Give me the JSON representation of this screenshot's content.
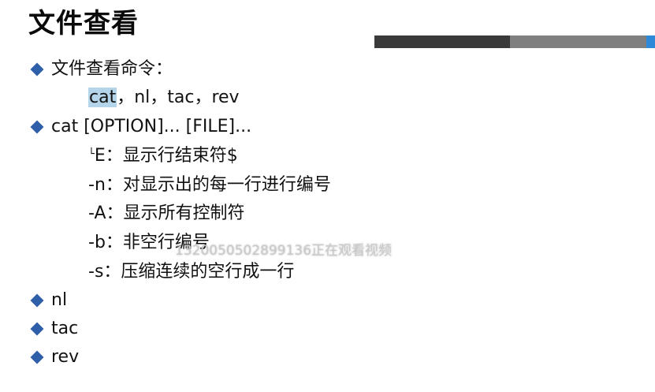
{
  "title": "文件查看",
  "colors": {
    "bullet": "#2f5fa8",
    "accent_dark": "#3a3a3a",
    "accent_gray": "#7f7f7f",
    "accent_blue": "#2e8ad8",
    "highlight": "#b4d4ea"
  },
  "bullets": {
    "b1": "文件查看命令：",
    "b1_sub_highlight": "cat",
    "b1_sub_rest": "，nl，tac，rev",
    "b2": "cat [OPTION]... [FILE]...",
    "b2_opts": [
      "E：显示行结束符$",
      "-n：对显示出的每一行进行编号",
      "-A：显示所有控制符",
      "-b：非空行编号",
      "-s：压缩连续的空行成一行"
    ],
    "b2_opt0_prefix": "└-",
    "b3": "nl",
    "b4": "tac",
    "b5": "rev"
  },
  "watermark": "1320050502899136正在观看视频"
}
